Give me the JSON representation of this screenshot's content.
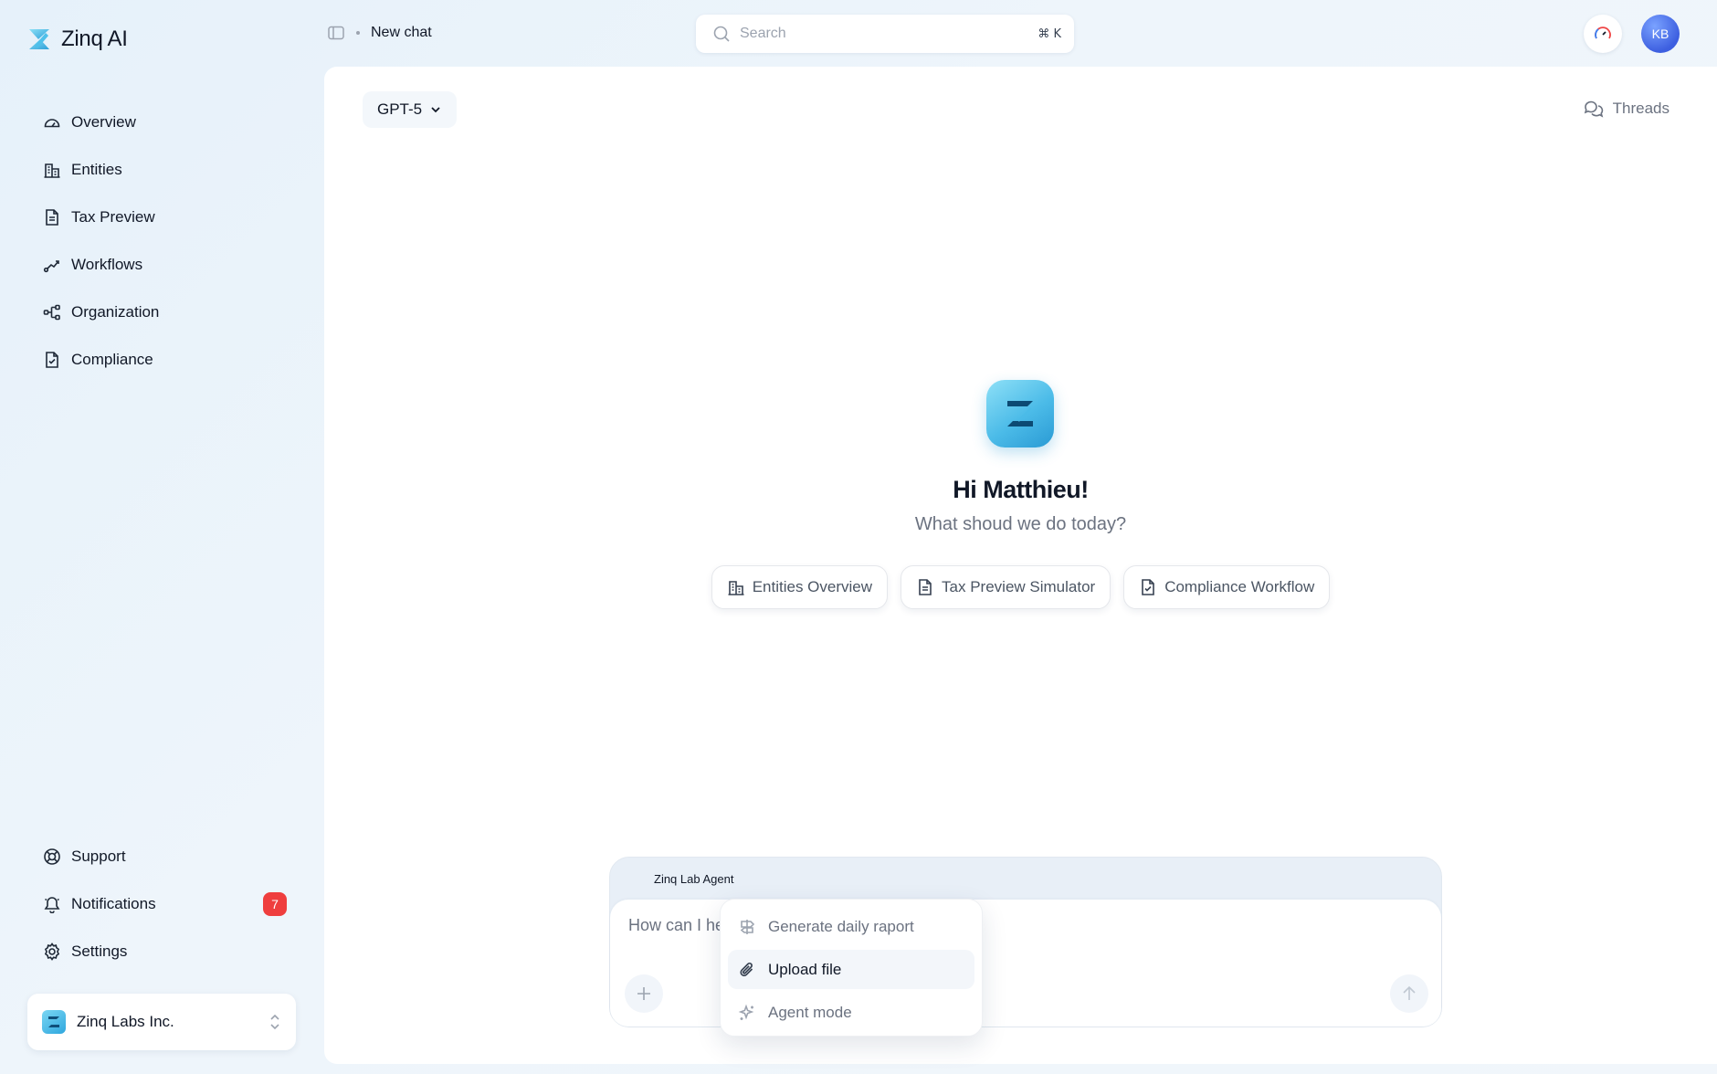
{
  "brand": {
    "name": "Zinq AI",
    "icon": "zinq-logo-icon"
  },
  "sidebar": {
    "items": [
      {
        "label": "Overview",
        "icon": "gauge-icon"
      },
      {
        "label": "Entities",
        "icon": "building-icon"
      },
      {
        "label": "Tax Preview",
        "icon": "document-icon"
      },
      {
        "label": "Workflows",
        "icon": "workflow-icon"
      },
      {
        "label": "Organization",
        "icon": "org-tree-icon"
      },
      {
        "label": "Compliance",
        "icon": "document-check-icon"
      }
    ],
    "bottom": [
      {
        "label": "Support",
        "icon": "lifebuoy-icon"
      },
      {
        "label": "Notifications",
        "icon": "bell-icon",
        "badge": "7"
      },
      {
        "label": "Settings",
        "icon": "gear-icon"
      }
    ],
    "org": {
      "name": "Zinq Labs Inc.",
      "icon": "chevron-up-down-icon"
    }
  },
  "header": {
    "breadcrumb": "New chat",
    "search": {
      "placeholder": "Search",
      "shortcut": "⌘ K"
    },
    "avatar": "KB"
  },
  "main": {
    "model": "GPT-5",
    "threads_label": "Threads",
    "greeting": "Hi Matthieu!",
    "subtitle": "What shoud we do today?",
    "chips": [
      {
        "label": "Entities Overview",
        "icon": "building-icon"
      },
      {
        "label": "Tax Preview Simulator",
        "icon": "document-icon"
      },
      {
        "label": "Compliance Workflow",
        "icon": "document-check-icon"
      }
    ],
    "composer": {
      "agent_label": "Zinq Lab Agent",
      "placeholder": "How can I help you today?"
    },
    "menu": [
      {
        "label": "Generate daily raport",
        "icon": "signpost-icon"
      },
      {
        "label": "Upload file",
        "icon": "paperclip-icon",
        "active": true
      },
      {
        "label": "Agent mode",
        "icon": "sparkle-icon"
      }
    ]
  },
  "colors": {
    "accent": "#2fa7de",
    "badge": "#ef3e3e",
    "avatar": "#3d5fe0"
  }
}
